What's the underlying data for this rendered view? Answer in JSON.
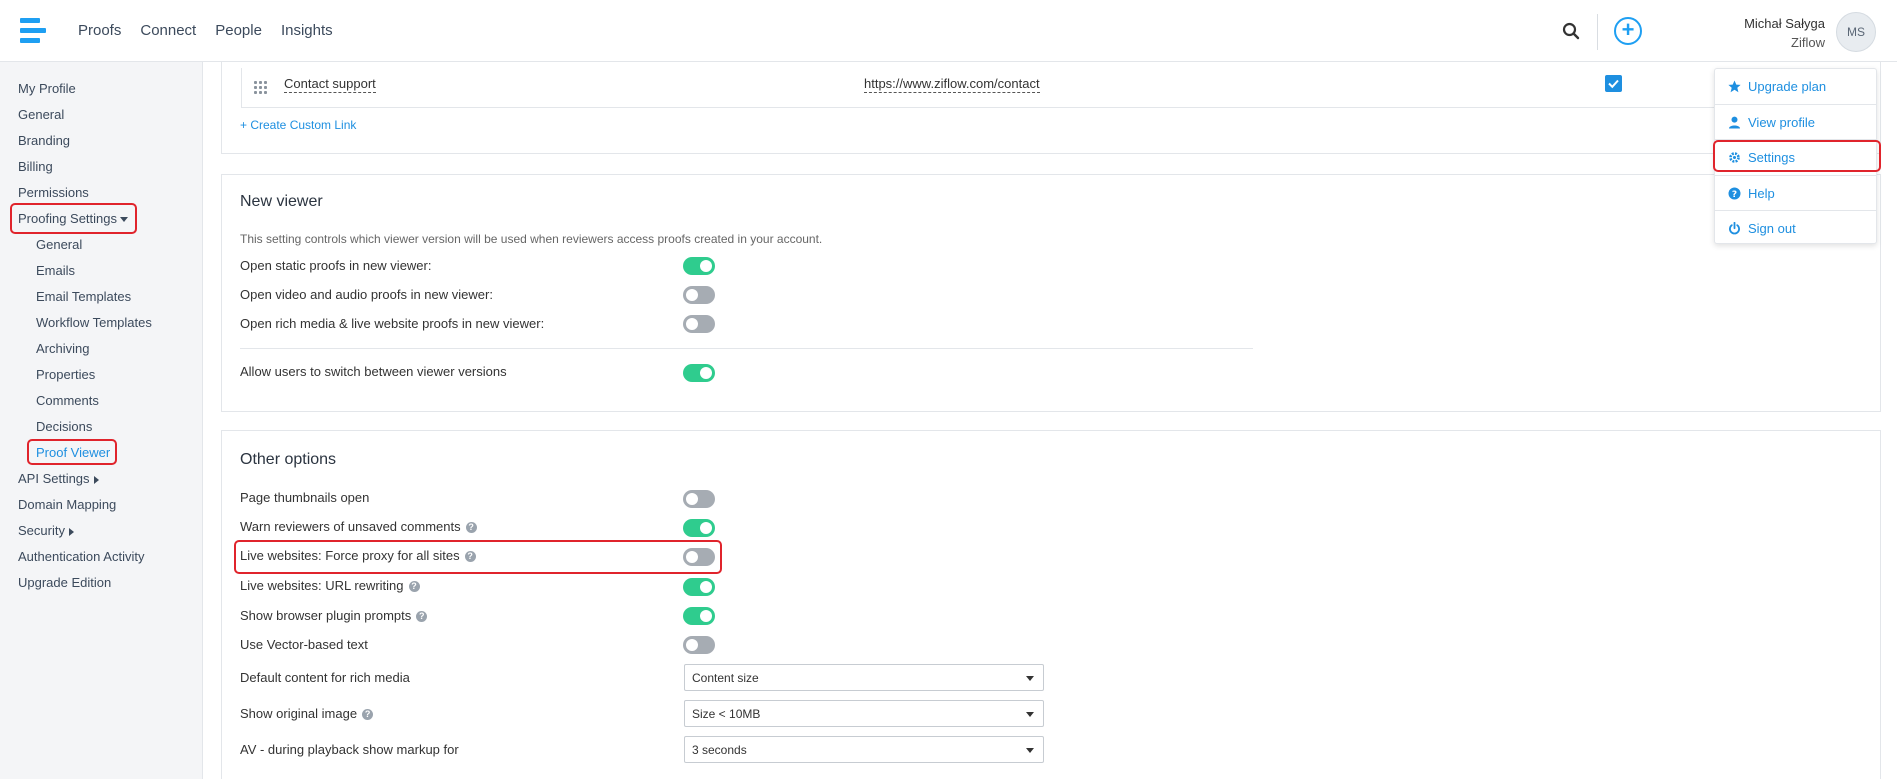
{
  "header": {
    "nav": [
      "Proofs",
      "Connect",
      "People",
      "Insights"
    ],
    "user_name": "Michał Sałyga",
    "user_org": "Ziflow",
    "avatar_initials": "MS",
    "accent_color": "#1e9ff2"
  },
  "sidebar": {
    "items": [
      "My Profile",
      "General",
      "Branding",
      "Billing",
      "Permissions"
    ],
    "proofing_settings": "Proofing Settings",
    "sub_items": [
      "General",
      "Emails",
      "Email Templates",
      "Workflow Templates",
      "Archiving",
      "Properties",
      "Comments",
      "Decisions"
    ],
    "proof_viewer": "Proof Viewer",
    "api_settings": "API Settings",
    "domain_mapping": "Domain Mapping",
    "security": "Security",
    "auth_activity": "Authentication Activity",
    "upgrade_edition": "Upgrade Edition"
  },
  "custom_links": {
    "row_name": "Contact support",
    "row_url": "https://www.ziflow.com/contact",
    "row_checked": true,
    "create_link": "+ Create Custom Link"
  },
  "new_viewer": {
    "title": "New viewer",
    "description": "This setting controls which viewer version will be used when reviewers access proofs created in your account.",
    "rows": [
      {
        "label": "Open static proofs in new viewer:",
        "on": true
      },
      {
        "label": "Open video and audio proofs in new viewer:",
        "on": false
      },
      {
        "label": "Open rich media & live website proofs in new viewer:",
        "on": false
      }
    ],
    "allow_switch": {
      "label": "Allow users to switch between viewer versions",
      "on": true
    }
  },
  "other_options": {
    "title": "Other options",
    "toggles": [
      {
        "label": "Page thumbnails open",
        "on": false,
        "help": false
      },
      {
        "label": "Warn reviewers of unsaved comments",
        "on": true,
        "help": true
      },
      {
        "label": "Live websites: Force proxy for all sites",
        "on": false,
        "help": true
      },
      {
        "label": "Live websites: URL rewriting",
        "on": true,
        "help": true
      },
      {
        "label": "Show browser plugin prompts",
        "on": true,
        "help": true
      },
      {
        "label": "Use Vector-based text",
        "on": false,
        "help": false
      }
    ],
    "selects": [
      {
        "label": "Default content for rich media",
        "value": "Content size",
        "help": false
      },
      {
        "label": "Show original image",
        "value": "Size < 10MB",
        "help": true
      },
      {
        "label": "AV - during playback show markup for",
        "value": "3 seconds",
        "help": false
      }
    ]
  },
  "user_menu": {
    "items": [
      "Upgrade plan",
      "View profile",
      "Settings",
      "Help",
      "Sign out"
    ]
  },
  "toggle_colors": {
    "on": "#2fcc8e",
    "off": "#a6acb3"
  }
}
